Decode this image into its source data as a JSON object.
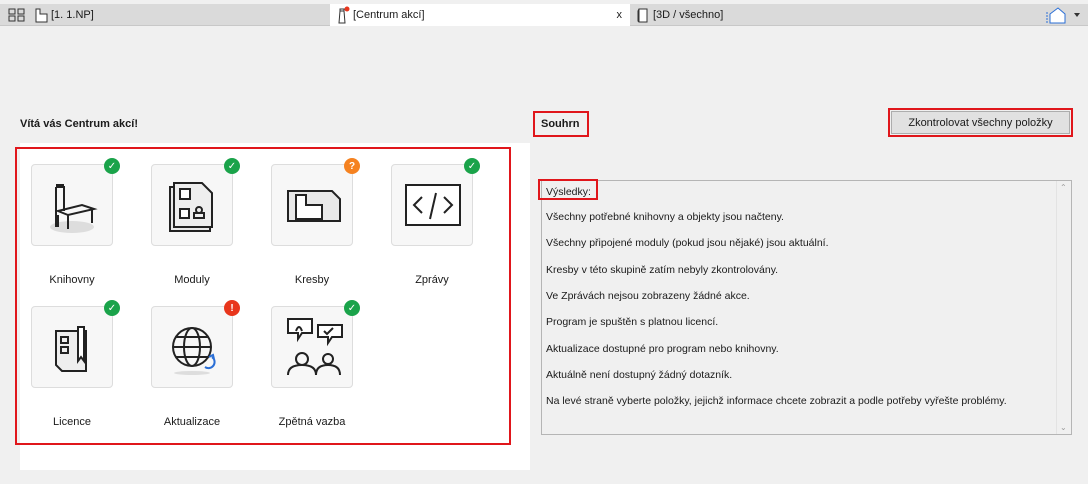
{
  "tabs": [
    {
      "label": "[1. 1.NP]"
    },
    {
      "label": "[Centrum akcí]",
      "active": true,
      "close": "x"
    },
    {
      "label": "[3D / všechno]"
    }
  ],
  "welcome": "Vítá vás Centrum akcí!",
  "tiles": [
    {
      "label": "Knihovny",
      "status": "ok",
      "icon": "chair-icon"
    },
    {
      "label": "Moduly",
      "status": "ok",
      "icon": "module-icon"
    },
    {
      "label": "Kresby",
      "status": "unknown",
      "icon": "drawing-icon"
    },
    {
      "label": "Zprávy",
      "status": "ok",
      "icon": "code-icon"
    },
    {
      "label": "Licence",
      "status": "ok",
      "icon": "license-icon"
    },
    {
      "label": "Aktualizace",
      "status": "error",
      "icon": "globe-update-icon"
    },
    {
      "label": "Zpětná vazba",
      "status": "ok",
      "icon": "feedback-icon"
    }
  ],
  "badges": {
    "ok": "✓",
    "unknown": "?",
    "error": "!"
  },
  "colors": {
    "ok": "#1aa34a",
    "unknown": "#f58220",
    "error": "#e8361c",
    "highlight": "#e0161b"
  },
  "summary": {
    "title": "Souhrn",
    "check_all": "Zkontrolovat všechny položky",
    "results_label": "Výsledky:",
    "lines": [
      "Všechny potřebné knihovny a objekty jsou načteny.",
      "Všechny připojené moduly (pokud jsou nějaké) jsou aktuální.",
      "Kresby v této skupině zatím nebyly zkontrolovány.",
      "Ve Zprávách nejsou zobrazeny žádné akce.",
      "Program je spuštěn s platnou licencí.",
      "Aktualizace dostupné pro program nebo knihovny.",
      "Aktuálně není dostupný žádný dotazník.",
      "Na levé straně vyberte položky, jejichž informace chcete zobrazit a podle potřeby vyřešte problémy."
    ]
  }
}
